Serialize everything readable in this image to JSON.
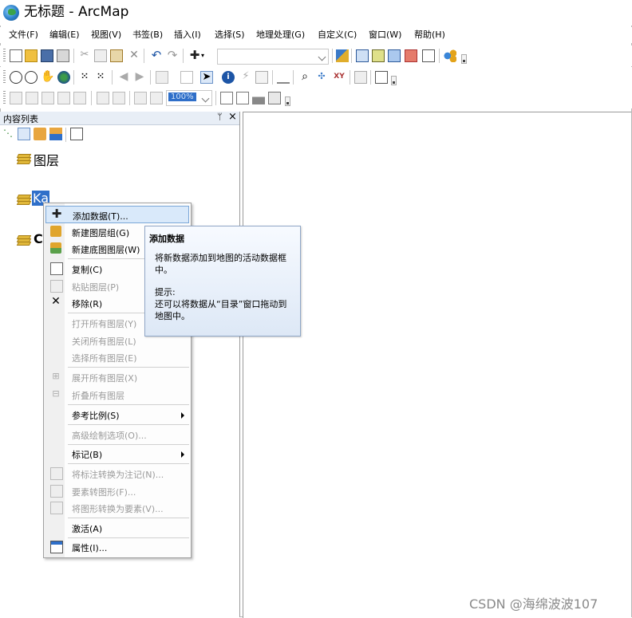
{
  "window": {
    "title": "无标题 - ArcMap"
  },
  "menu": [
    "文件(F)",
    "编辑(E)",
    "视图(V)",
    "书签(B)",
    "插入(I)",
    "选择(S)",
    "地理处理(G)",
    "自定义(C)",
    "窗口(W)",
    "帮助(H)"
  ],
  "toolbar3": {
    "scale_value": "100%"
  },
  "toc": {
    "title": "内容列表",
    "pin": "ᛘ",
    "close": "×",
    "layers": [
      {
        "label": "图层"
      },
      {
        "label": "Ka"
      },
      {
        "label": "C"
      }
    ]
  },
  "context_menu": {
    "items": [
      {
        "label": "添加数据(T)...",
        "icon": "add-data-icon",
        "disabled": false,
        "highlighted": true
      },
      {
        "label": "新建图层组(G)",
        "icon": "new-group-layer-icon",
        "disabled": false
      },
      {
        "label": "新建底图图层(W)",
        "icon": "new-basemap-layer-icon",
        "disabled": false
      },
      {
        "label": "复制(C)",
        "icon": "copy-icon",
        "disabled": false
      },
      {
        "label": "粘贴图层(P)",
        "icon": "paste-icon",
        "disabled": true
      },
      {
        "label": "移除(R)",
        "icon": "remove-icon",
        "disabled": false
      },
      {
        "label": "打开所有图层(Y)",
        "disabled": true
      },
      {
        "label": "关闭所有图层(L)",
        "disabled": true
      },
      {
        "label": "选择所有图层(E)",
        "disabled": true
      },
      {
        "label": "展开所有图层(X)",
        "icon": "expand-icon",
        "disabled": true
      },
      {
        "label": "折叠所有图层",
        "icon": "collapse-icon",
        "disabled": true
      },
      {
        "label": "参考比例(S)",
        "disabled": false,
        "submenu": true
      },
      {
        "label": "高级绘制选项(O)...",
        "disabled": true
      },
      {
        "label": "标记(B)",
        "disabled": false,
        "submenu": true
      },
      {
        "label": "将标注转换为注记(N)...",
        "icon": "convert-labels-icon",
        "disabled": true
      },
      {
        "label": "要素转图形(F)...",
        "icon": "features-to-graphics-icon",
        "disabled": true
      },
      {
        "label": "将图形转换为要素(V)...",
        "icon": "graphics-to-features-icon",
        "disabled": true
      },
      {
        "label": "激活(A)",
        "disabled": false
      },
      {
        "label": "属性(I)...",
        "icon": "properties-icon",
        "disabled": false
      }
    ]
  },
  "tooltip": {
    "title": "添加数据",
    "line1": "将新数据添加到地图的活动数据框中。",
    "hint_title": "提示:",
    "hint_body": "还可以将数据从“目录”窗口拖动到地图中。"
  },
  "watermark": "CSDN @海绵波波107",
  "colors": {
    "highlight": "#d9e9fa",
    "selected_layer": "#2f6fc9",
    "tooltip_border": "#8fa6c6"
  }
}
